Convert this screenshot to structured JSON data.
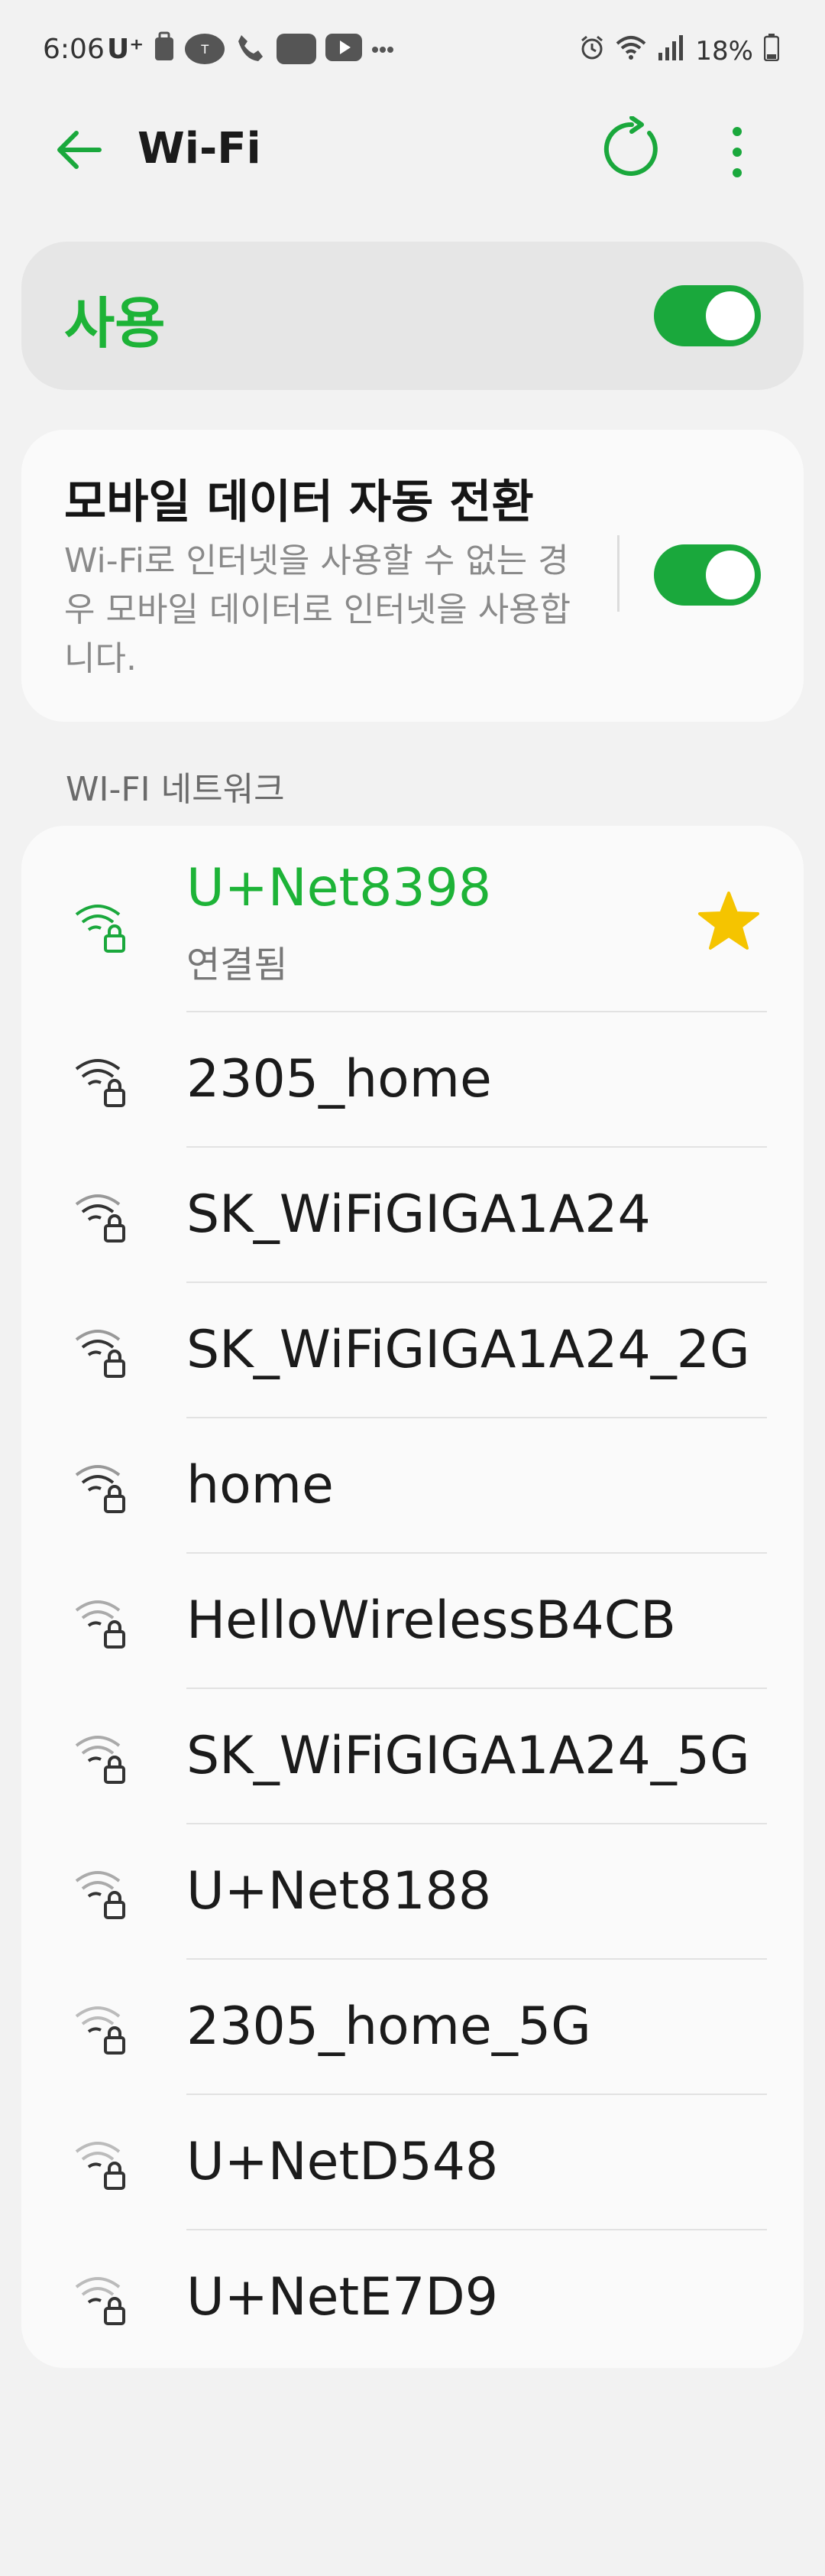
{
  "status_bar": {
    "time": "6:06",
    "carrier": "U⁺",
    "battery_percent": "18%",
    "icons": [
      "suitcase-icon",
      "tmon-icon",
      "call-icon",
      "app-icon",
      "youtube-icon",
      "more-dots-icon",
      "alarm-icon",
      "wifi-icon",
      "signal-icon",
      "battery-icon"
    ]
  },
  "appbar": {
    "title": "Wi-Fi",
    "accent": "#1db337"
  },
  "wifi_toggle": {
    "label": "사용",
    "on": true
  },
  "auto_switch": {
    "title": "모바일 데이터 자동 전환",
    "description": "Wi-Fi로 인터넷을 사용할 수 없는 경우 모바일 데이터로 인터넷을 사용합니다.",
    "on": true
  },
  "networks_section": {
    "header": "WI-FI 네트워크",
    "items": [
      {
        "name": "U+Net8398",
        "status": "연결됨",
        "connected": true,
        "favorite": true
      },
      {
        "name": "2305_home"
      },
      {
        "name": "SK_WiFiGIGA1A24"
      },
      {
        "name": "SK_WiFiGIGA1A24_2G"
      },
      {
        "name": "home"
      },
      {
        "name": "HelloWirelessB4CB"
      },
      {
        "name": "SK_WiFiGIGA1A24_5G"
      },
      {
        "name": "U+Net8188"
      },
      {
        "name": "2305_home_5G"
      },
      {
        "name": "U+NetD548"
      },
      {
        "name": "U+NetE7D9"
      }
    ]
  }
}
